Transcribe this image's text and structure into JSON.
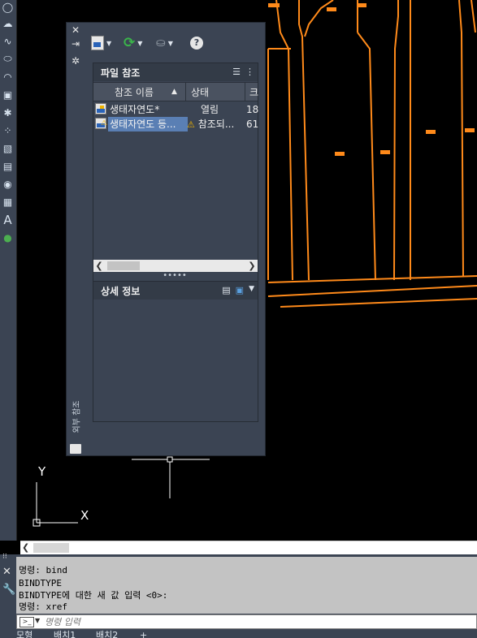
{
  "colors": {
    "drawing_lines": "#ff8a1a",
    "canvas": "#000000",
    "panel": "#3b4453",
    "selection": "#5a7fb4",
    "warning": "#f0b400"
  },
  "left_toolbar": {
    "icons": [
      "circle-icon",
      "cloud-icon",
      "spline-icon",
      "ellipse-icon",
      "ellipse-arc-icon",
      "insert-block-icon",
      "create-block-icon",
      "point-icon",
      "hatch-icon",
      "gradient-icon",
      "region-icon",
      "table-icon",
      "multiline-text-icon",
      "add-selected-icon"
    ]
  },
  "xref_palette": {
    "vertical_title": "외부 참조",
    "file_references": {
      "title": "파일 참조",
      "columns": {
        "name": "참조 이름",
        "status": "상태",
        "size": "크"
      },
      "rows": [
        {
          "name": "생태자연도*",
          "status": "열림",
          "size": "18",
          "icon": "dwg-file-icon"
        },
        {
          "name": "생태자연도 등...",
          "status": "참조되...",
          "size": "61",
          "icon": "xref-warning-file-icon"
        }
      ]
    },
    "details": {
      "title": "상세 정보"
    }
  },
  "ucs": {
    "x_label": "X",
    "y_label": "Y"
  },
  "command_line": {
    "history": [
      "명령: bind",
      "BINDTYPE",
      "BINDTYPE에 대한 새 값 입력 <0>:",
      "명령: xref"
    ],
    "input_placeholder": "명령 입력"
  },
  "layout_tabs": [
    "모형",
    "배치1",
    "배치2",
    "+"
  ]
}
